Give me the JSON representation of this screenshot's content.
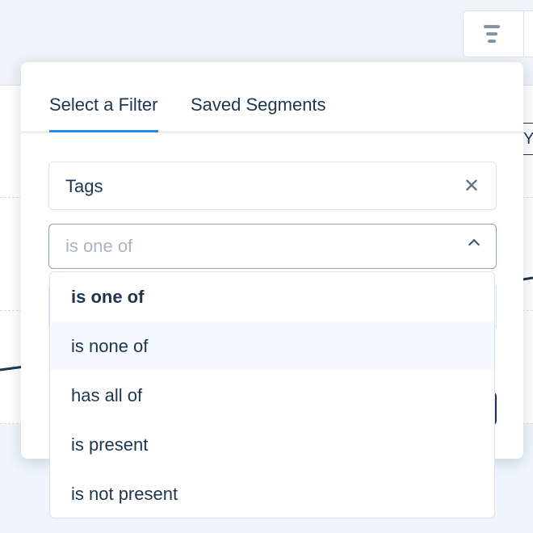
{
  "toolbar": {
    "filter_icon": "filter-lines-icon",
    "partial_label": "Y"
  },
  "panel": {
    "tabs": [
      {
        "label": "Select a Filter",
        "active": true
      },
      {
        "label": "Saved Segments",
        "active": false
      }
    ],
    "property_field": {
      "value": "Tags",
      "clear_icon": "close-icon"
    },
    "operator_select": {
      "placeholder": "is one of",
      "icon": "chevron-up-icon"
    },
    "operator_options": [
      {
        "label": "is one of",
        "selected": true
      },
      {
        "label": "is none of",
        "hovered": true
      },
      {
        "label": "has all of"
      },
      {
        "label": "is present"
      },
      {
        "label": "is not present"
      }
    ]
  },
  "colors": {
    "accent": "#2a8ae8",
    "text": "#1c3550"
  }
}
